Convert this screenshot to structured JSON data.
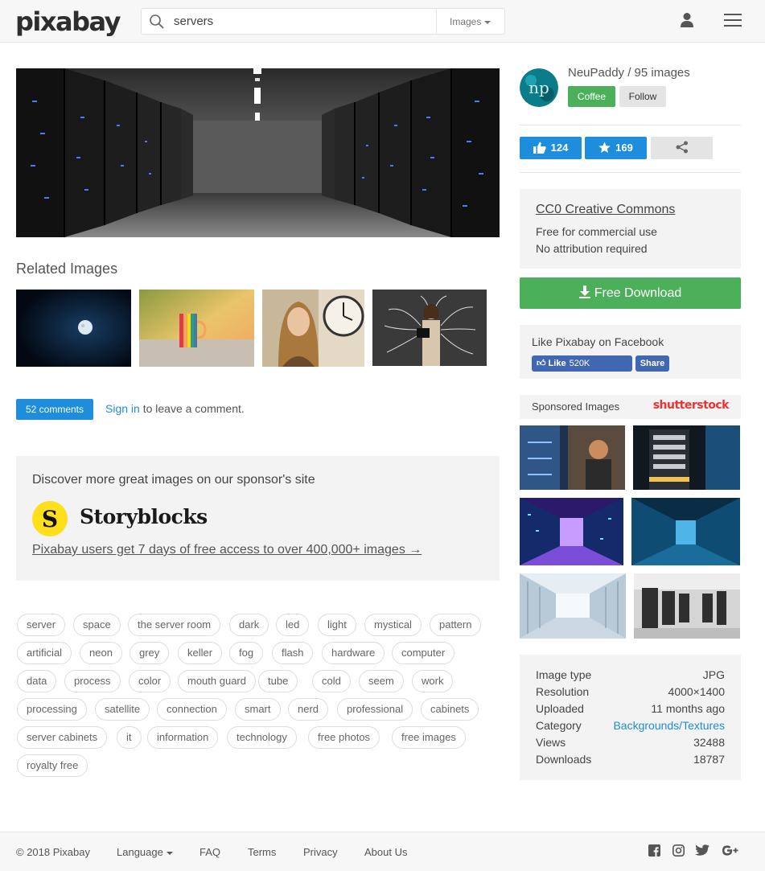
{
  "header": {
    "logo": "pixabay",
    "search_value": "servers",
    "search_type": "Images"
  },
  "related": {
    "title": "Related Images"
  },
  "comments": {
    "button": "52 comments",
    "signin_link": "Sign in",
    "signin_rest": " to leave a comment."
  },
  "sponsor": {
    "title": "Discover more great images on our sponsor's site",
    "logo_letter": "S",
    "name": "Storyblocks",
    "link": "Pixabay users get 7 days of free access to over 400,000+ images →"
  },
  "tags": [
    "server",
    "space",
    "the server room",
    "dark",
    "led",
    "light",
    "mystical",
    "pattern",
    "artificial",
    "neon",
    "grey",
    "keller",
    "fog",
    "flash",
    "hardware",
    "computer",
    "data",
    "process",
    "color",
    "mouth guard",
    "tube",
    "cold",
    "seem",
    "work",
    "processing",
    "satellite",
    "connection",
    "smart",
    "nerd",
    "professional",
    "cabinets",
    "server cabinets",
    "it",
    "information",
    "technology",
    "free photos",
    "free images",
    "royalty free"
  ],
  "author": {
    "name_line": "NeuPaddy / 95 images",
    "coffee": "Coffee",
    "follow": "Follow"
  },
  "stats": {
    "likes": "124",
    "favorites": "169"
  },
  "license": {
    "title": "CC0 Creative Commons",
    "line1": "Free for commercial use",
    "line2": "No attribution required"
  },
  "download": {
    "label": "Free Download"
  },
  "facebook": {
    "title": "Like Pixabay on Facebook",
    "like": "Like",
    "count": "520K",
    "share": "Share"
  },
  "sponsored": {
    "title": "Sponsored Images",
    "brand": "shutterstock"
  },
  "info": [
    {
      "label": "Image type",
      "value": "JPG"
    },
    {
      "label": "Resolution",
      "value": "4000×1400"
    },
    {
      "label": "Uploaded",
      "value": "11 months ago"
    },
    {
      "label": "Category",
      "value": "Backgrounds/Textures"
    },
    {
      "label": "Views",
      "value": "32488"
    },
    {
      "label": "Downloads",
      "value": "18787"
    }
  ],
  "footer": {
    "copyright": "© 2018 Pixabay",
    "language": "Language",
    "faq": "FAQ",
    "terms": "Terms",
    "privacy": "Privacy",
    "about": "About Us"
  },
  "colors": {
    "accent_blue": "#1e8ddc",
    "download_green": "#4cb05a",
    "facebook_blue": "#4267b2",
    "panel_gray": "#f3f3f3"
  },
  "icons": [
    "search-icon",
    "user-icon",
    "menu-icon",
    "thumbs-up-icon",
    "star-icon",
    "share-icon",
    "download-icon",
    "facebook-icon",
    "instagram-icon",
    "twitter-icon",
    "google-plus-icon"
  ]
}
